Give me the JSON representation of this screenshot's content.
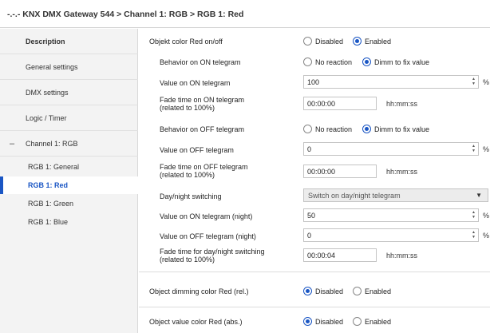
{
  "window": {
    "title": "-.-.- KNX DMX Gateway 544 > Channel 1: RGB > RGB 1: Red"
  },
  "sidebar": {
    "items": [
      {
        "label": "Description"
      },
      {
        "label": "General settings"
      },
      {
        "label": "DMX settings"
      },
      {
        "label": "Logic / Timer"
      },
      {
        "label": "Channel 1: RGB",
        "expander": "–"
      }
    ],
    "sub_items": [
      {
        "label": "RGB 1: General"
      },
      {
        "label": "RGB 1: Red"
      },
      {
        "label": "RGB 1: Green"
      },
      {
        "label": "RGB 1: Blue"
      }
    ]
  },
  "params": {
    "color_onoff": {
      "label": "Objekt color Red on/off",
      "opt1": "Disabled",
      "opt2": "Enabled",
      "selected": "Enabled"
    },
    "behavior_on": {
      "label": "Behavior on ON telegram",
      "opt1": "No reaction",
      "opt2": "Dimm to fix value",
      "selected": "Dimm to fix value"
    },
    "value_on": {
      "label": "Value on ON telegram",
      "value": "100",
      "unit": "%"
    },
    "fade_on": {
      "label_line1": "Fade time on ON telegram",
      "label_line2": "(related to 100%)",
      "value": "00:00:00",
      "unit": "hh:mm:ss"
    },
    "behavior_off": {
      "label": "Behavior on OFF telegram",
      "opt1": "No reaction",
      "opt2": "Dimm to fix value",
      "selected": "Dimm to fix value"
    },
    "value_off": {
      "label": "Value on OFF telegram",
      "value": "0",
      "unit": "%"
    },
    "fade_off": {
      "label_line1": "Fade time on OFF telegram",
      "label_line2": "(related to 100%)",
      "value": "00:00:00",
      "unit": "hh:mm:ss"
    },
    "daynight": {
      "label": "Day/night switching",
      "value": "Switch on day/night telegram"
    },
    "value_on_night": {
      "label": "Value on ON telegram (night)",
      "value": "50",
      "unit": "%"
    },
    "value_off_night": {
      "label": "Value on OFF telegram (night)",
      "value": "0",
      "unit": "%"
    },
    "fade_daynight": {
      "label_line1": "Fade time for day/night switching",
      "label_line2": "(related to 100%)",
      "value": "00:00:04",
      "unit": "hh:mm:ss"
    },
    "dimming_rel": {
      "label": "Object dimming color Red (rel.)",
      "opt1": "Disabled",
      "opt2": "Enabled",
      "selected": "Disabled"
    },
    "value_abs": {
      "label": "Object value color Red (abs.)",
      "opt1": "Disabled",
      "opt2": "Enabled",
      "selected": "Disabled"
    }
  },
  "colors": {
    "accent": "#1a56c4"
  },
  "icons": {
    "spin_arrows": "up-down-arrows-icon",
    "dropdown_caret": "caret-down-icon",
    "expander": "collapse-minus-icon"
  }
}
